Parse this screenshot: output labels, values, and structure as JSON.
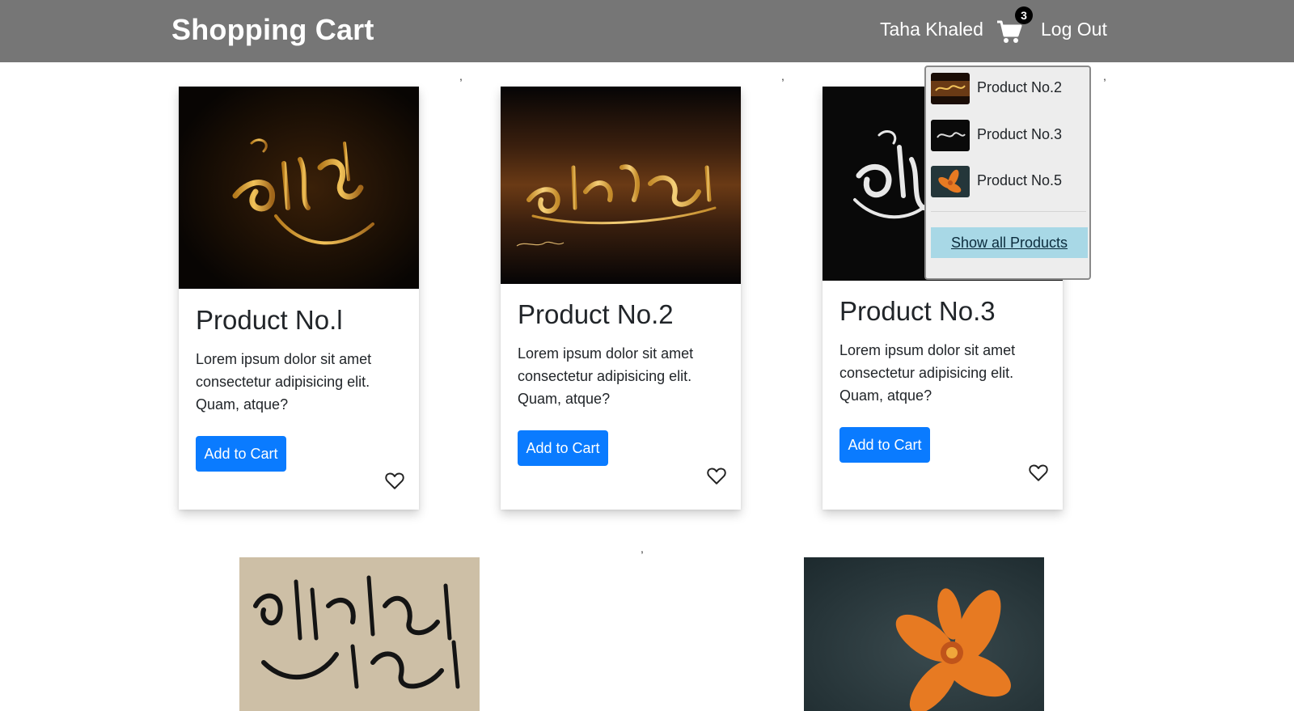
{
  "header": {
    "brand": "Shopping Cart",
    "user_name": "Taha Khaled",
    "cart_count": "3",
    "logout_label": "Log Out"
  },
  "products": [
    {
      "title": "Product No.l",
      "description": "Lorem ipsum dolor sit amet consectetur adipisicing elit. Quam, atque?",
      "button_label": "Add to Cart"
    },
    {
      "title": "Product No.2",
      "description": "Lorem ipsum dolor sit amet consectetur adipisicing elit. Quam, atque?",
      "button_label": "Add to Cart"
    },
    {
      "title": "Product No.3",
      "description": "Lorem ipsum dolor sit amet consectetur adipisicing elit. Quam, atque?",
      "button_label": "Add to Cart"
    }
  ],
  "cart_dropdown": {
    "items": [
      {
        "label": "Product No.2"
      },
      {
        "label": "Product No.3"
      },
      {
        "label": "Product No.5"
      }
    ],
    "show_all_label": "Show all Products"
  },
  "separators": [
    ",",
    ",",
    ",",
    ","
  ],
  "icons": {
    "cart": "cart-icon",
    "heart": "heart-outline-icon"
  },
  "colors": {
    "navbar": "#767676",
    "primary_button": "#0a7bff",
    "show_all_bg": "#a8d8e6"
  }
}
